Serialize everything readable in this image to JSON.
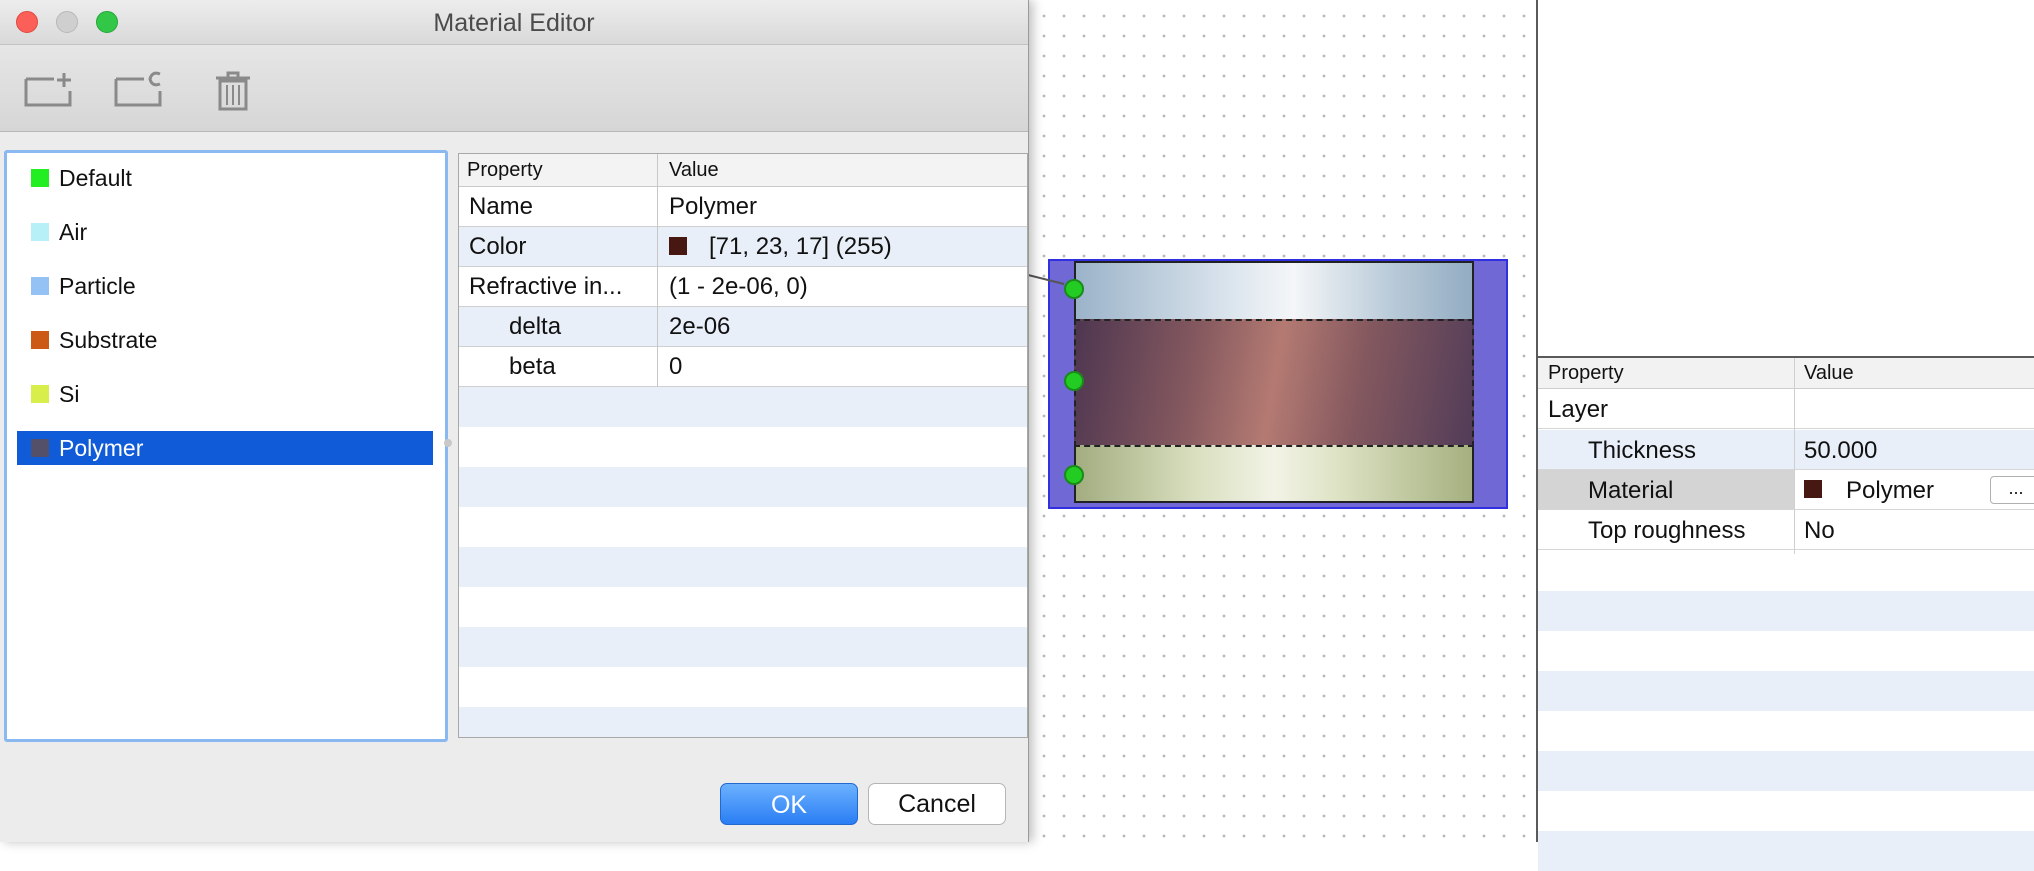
{
  "editor": {
    "title": "Material Editor",
    "toolbar": {
      "add_icon": "add-material-icon",
      "clone_icon": "clone-material-icon",
      "remove_icon": "remove-material-icon"
    },
    "materials": [
      {
        "name": "Default",
        "color": "#22ee22"
      },
      {
        "name": "Air",
        "color": "#b8f0f8"
      },
      {
        "name": "Particle",
        "color": "#94c2f4"
      },
      {
        "name": "Substrate",
        "color": "#cc5a14"
      },
      {
        "name": "Si",
        "color": "#d8ee4a"
      },
      {
        "name": "Polymer",
        "color": "#55506a"
      }
    ],
    "selected_material": "Polymer",
    "properties": {
      "header_property": "Property",
      "header_value": "Value",
      "rows": [
        {
          "key": "Name",
          "value": "Polymer",
          "indent": false
        },
        {
          "key": "Color",
          "value": "[71, 23, 17] (255)",
          "indent": false,
          "swatch": "#471711"
        },
        {
          "key": "Refractive in...",
          "value": "(1 - 2e-06, 0)",
          "indent": false
        },
        {
          "key": "delta",
          "value": "2e-06",
          "indent": true
        },
        {
          "key": "beta",
          "value": "0",
          "indent": true
        }
      ]
    },
    "ok_label": "OK",
    "cancel_label": "Cancel"
  },
  "right_panel": {
    "header_property": "Property",
    "header_value": "Value",
    "group": "Layer",
    "rows": [
      {
        "key": "Thickness",
        "value": "50.000"
      },
      {
        "key": "Material",
        "value": "Polymer",
        "swatch": "#471711",
        "button": "..."
      },
      {
        "key": "Top roughness",
        "value": "No"
      }
    ]
  },
  "colors": {
    "selection": "#0f5bd8",
    "ok_button": "#2a7df4",
    "widget_frame": "#3030e0"
  }
}
